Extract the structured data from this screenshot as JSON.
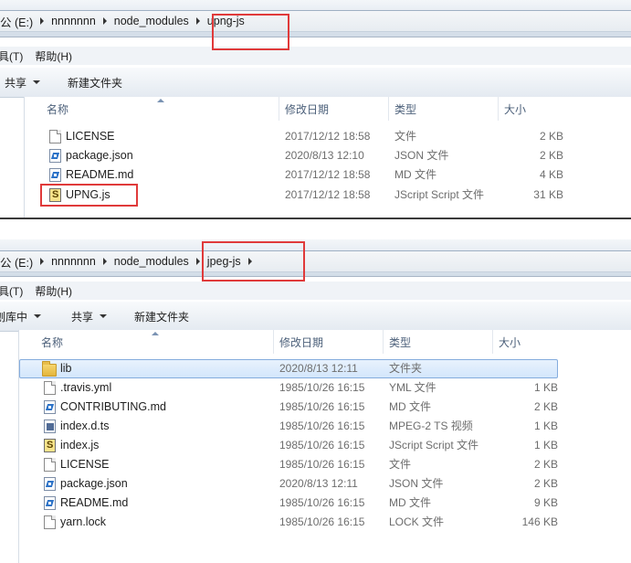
{
  "panel1": {
    "breadcrumb": [
      "公 (E:)",
      "nnnnnnn",
      "node_modules",
      "upng-js"
    ],
    "menus": [
      "具(T)",
      "帮助(H)"
    ],
    "toolbar": [
      {
        "label": "共享",
        "dropdown": true
      },
      {
        "label": "新建文件夹",
        "dropdown": false
      }
    ],
    "columns": [
      "名称",
      "修改日期",
      "类型",
      "大小"
    ],
    "files": [
      {
        "icon": "document-icon",
        "name": "LICENSE",
        "modified": "2017/12/12 18:58",
        "type": "文件",
        "size": "2 KB"
      },
      {
        "icon": "vscode-file-icon",
        "name": "package.json",
        "modified": "2020/8/13 12:10",
        "type": "JSON 文件",
        "size": "2 KB"
      },
      {
        "icon": "vscode-file-icon",
        "name": "README.md",
        "modified": "2017/12/12 18:58",
        "type": "MD 文件",
        "size": "4 KB"
      },
      {
        "icon": "jscript-file-icon",
        "name": "UPNG.js",
        "modified": "2017/12/12 18:58",
        "type": "JScript Script 文件",
        "size": "31 KB"
      }
    ]
  },
  "panel2": {
    "breadcrumb": [
      "公 (E:)",
      "nnnnnnn",
      "node_modules",
      "jpeg-js"
    ],
    "menus": [
      "具(T)",
      "帮助(H)"
    ],
    "toolbar": [
      {
        "label": "刨库中",
        "dropdown": true
      },
      {
        "label": "共享",
        "dropdown": true
      },
      {
        "label": "新建文件夹",
        "dropdown": false
      }
    ],
    "columns": [
      "名称",
      "修改日期",
      "类型",
      "大小"
    ],
    "files": [
      {
        "icon": "folder-icon",
        "name": "lib",
        "modified": "2020/8/13 12:11",
        "type": "文件夹",
        "size": "",
        "selected": true
      },
      {
        "icon": "document-icon",
        "name": ".travis.yml",
        "modified": "1985/10/26 16:15",
        "type": "YML 文件",
        "size": "1 KB"
      },
      {
        "icon": "vscode-file-icon",
        "name": "CONTRIBUTING.md",
        "modified": "1985/10/26 16:15",
        "type": "MD 文件",
        "size": "2 KB"
      },
      {
        "icon": "typescript-file-icon",
        "name": "index.d.ts",
        "modified": "1985/10/26 16:15",
        "type": "MPEG-2 TS 视频",
        "size": "1 KB"
      },
      {
        "icon": "jscript-file-icon",
        "name": "index.js",
        "modified": "1985/10/26 16:15",
        "type": "JScript Script 文件",
        "size": "1 KB"
      },
      {
        "icon": "document-icon",
        "name": "LICENSE",
        "modified": "1985/10/26 16:15",
        "type": "文件",
        "size": "2 KB"
      },
      {
        "icon": "vscode-file-icon",
        "name": "package.json",
        "modified": "2020/8/13 12:11",
        "type": "JSON 文件",
        "size": "2 KB"
      },
      {
        "icon": "vscode-file-icon",
        "name": "README.md",
        "modified": "1985/10/26 16:15",
        "type": "MD 文件",
        "size": "9 KB"
      },
      {
        "icon": "document-icon",
        "name": "yarn.lock",
        "modified": "1985/10/26 16:15",
        "type": "LOCK 文件",
        "size": "146 KB"
      }
    ]
  },
  "colors": {
    "highlight": "#e03a3a",
    "header_text": "#4c607a",
    "selection": "#d3e6fb"
  }
}
